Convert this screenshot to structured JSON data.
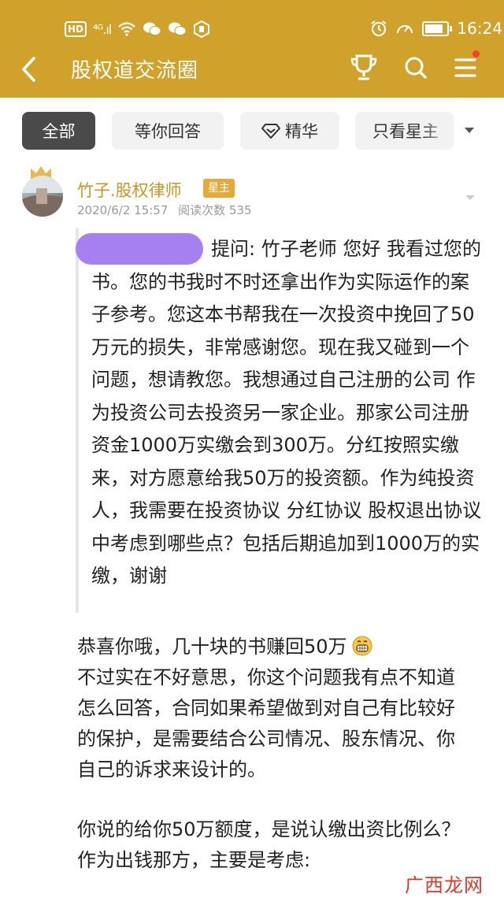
{
  "status_bar": {
    "network_badge": "HD",
    "signal": "⁴ᴳ.ıl",
    "time": "16:24",
    "battery_level": 0.85
  },
  "header": {
    "title": "股权道交流圈"
  },
  "tabs": [
    {
      "label": "全部",
      "selected": true
    },
    {
      "label": "等你回答",
      "selected": false
    },
    {
      "label": "精华",
      "selected": false
    },
    {
      "label": "只看星主",
      "selected": false
    }
  ],
  "post": {
    "author": "竹子.股权律师",
    "badge": "星主",
    "date": "2020/6/2 15:57",
    "reads": "阅读次数 535",
    "question": "提问: 竹子老师  您好  我看过您的书。您的书我时不时还拿出作为实际运作的案子参考。您这本书帮我在一次投资中挽回了50万元的损失，非常感谢您。现在我又碰到一个问题，想请教您。我想通过自己注册的公司  作为投资公司去投资另一家企业。那家公司注册资金1000万实缴会到300万。分红按照实缴来，对方愿意给我50万的投资额。作为纯投资人，我需要在投资协议  分红协议  股权退出协议中考虑到哪些点？包括后期追加到1000万的实缴，谢谢",
    "answer_line1": "恭喜你哦，几十块的书赚回50万",
    "answer_para1": "不过实在不好意思，你这个问题我有点不知道怎么回答，合同如果希望做到对自己有比较好的保护，是需要结合公司情况、股东情况、你自己的诉求来设计的。",
    "answer_para2": "你说的给你50万额度，是说认缴出资比例么？",
    "answer_para3": "作为出钱那方，主要是考虑:"
  },
  "watermark": "广西龙网",
  "colors": {
    "brand_gold": "#d0a22b",
    "author_gold": "#c8952a",
    "badge_orange": "#e7a83a",
    "redaction_purple": "#a67ff0"
  }
}
